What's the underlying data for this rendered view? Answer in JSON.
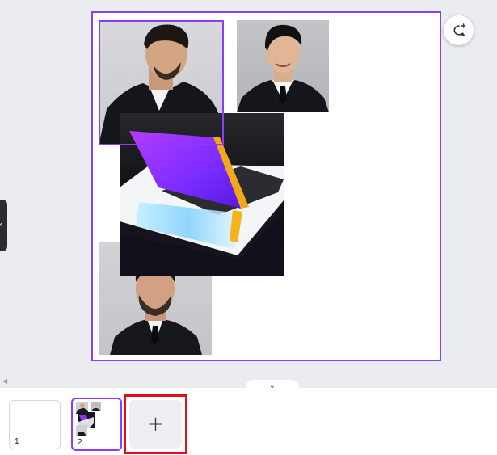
{
  "editor": {
    "expand_panel_glyph": "‹",
    "scroll_left_glyph": "◀",
    "collapse_glyph": "⌄"
  },
  "canvas": {
    "images": [
      {
        "id": "photo-man-profile",
        "icon": "portrait-photo"
      },
      {
        "id": "photo-man-smiling",
        "icon": "portrait-photo"
      },
      {
        "id": "photo-laptop",
        "icon": "laptop-photo"
      },
      {
        "id": "photo-man-beard",
        "icon": "portrait-photo"
      }
    ],
    "selection_color": "#8b3dff"
  },
  "magic_button": {
    "icon": "magic-comment-icon"
  },
  "pages": [
    {
      "number": "1"
    },
    {
      "number": "2",
      "selected": true
    }
  ],
  "add_page": {
    "glyph": "+",
    "highlight_color": "#e0101a"
  },
  "colors": {
    "accent": "#8b3dff",
    "background": "#ebecf0"
  }
}
